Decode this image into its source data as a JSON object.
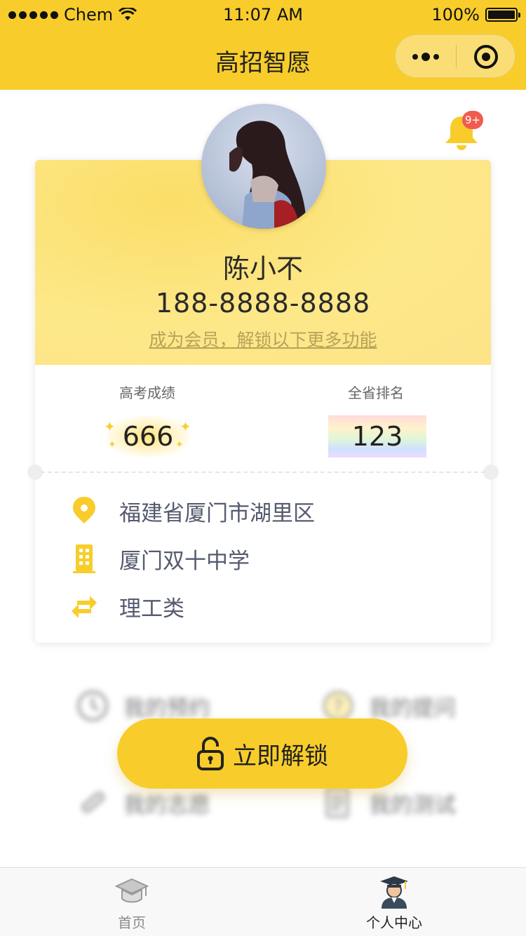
{
  "status_bar": {
    "carrier": "Chem",
    "time": "11:07 AM",
    "battery": "100%"
  },
  "nav": {
    "title": "高招智愿"
  },
  "notifications": {
    "badge": "9+"
  },
  "profile": {
    "name": "陈小不",
    "phone": "188-8888-8888",
    "member_link": "成为会员，解锁以下更多功能"
  },
  "stats": {
    "score_label": "高考成绩",
    "score_value": "666",
    "rank_label": "全省排名",
    "rank_value": "123"
  },
  "info": [
    {
      "icon": "location-pin-icon",
      "text": "福建省厦门市湖里区"
    },
    {
      "icon": "building-icon",
      "text": "厦门双十中学"
    },
    {
      "icon": "swap-arrows-icon",
      "text": "理工类"
    }
  ],
  "menu": [
    {
      "icon": "clock-icon",
      "label": "我的预约"
    },
    {
      "icon": "question-icon",
      "label": "我的提问"
    },
    {
      "icon": "diploma-icon",
      "label": "我的志愿"
    },
    {
      "icon": "test-paper-icon",
      "label": "我的测试"
    }
  ],
  "unlock_button": {
    "label": "立即解锁",
    "icon": "unlock-icon"
  },
  "tabbar": [
    {
      "icon": "graduation-cap-icon",
      "label": "首页",
      "active": false
    },
    {
      "icon": "graduate-avatar-icon",
      "label": "个人中心",
      "active": true
    }
  ],
  "colors": {
    "brand": "#f8cd2b",
    "badge": "#f15b4f",
    "text": "#555a6e"
  }
}
